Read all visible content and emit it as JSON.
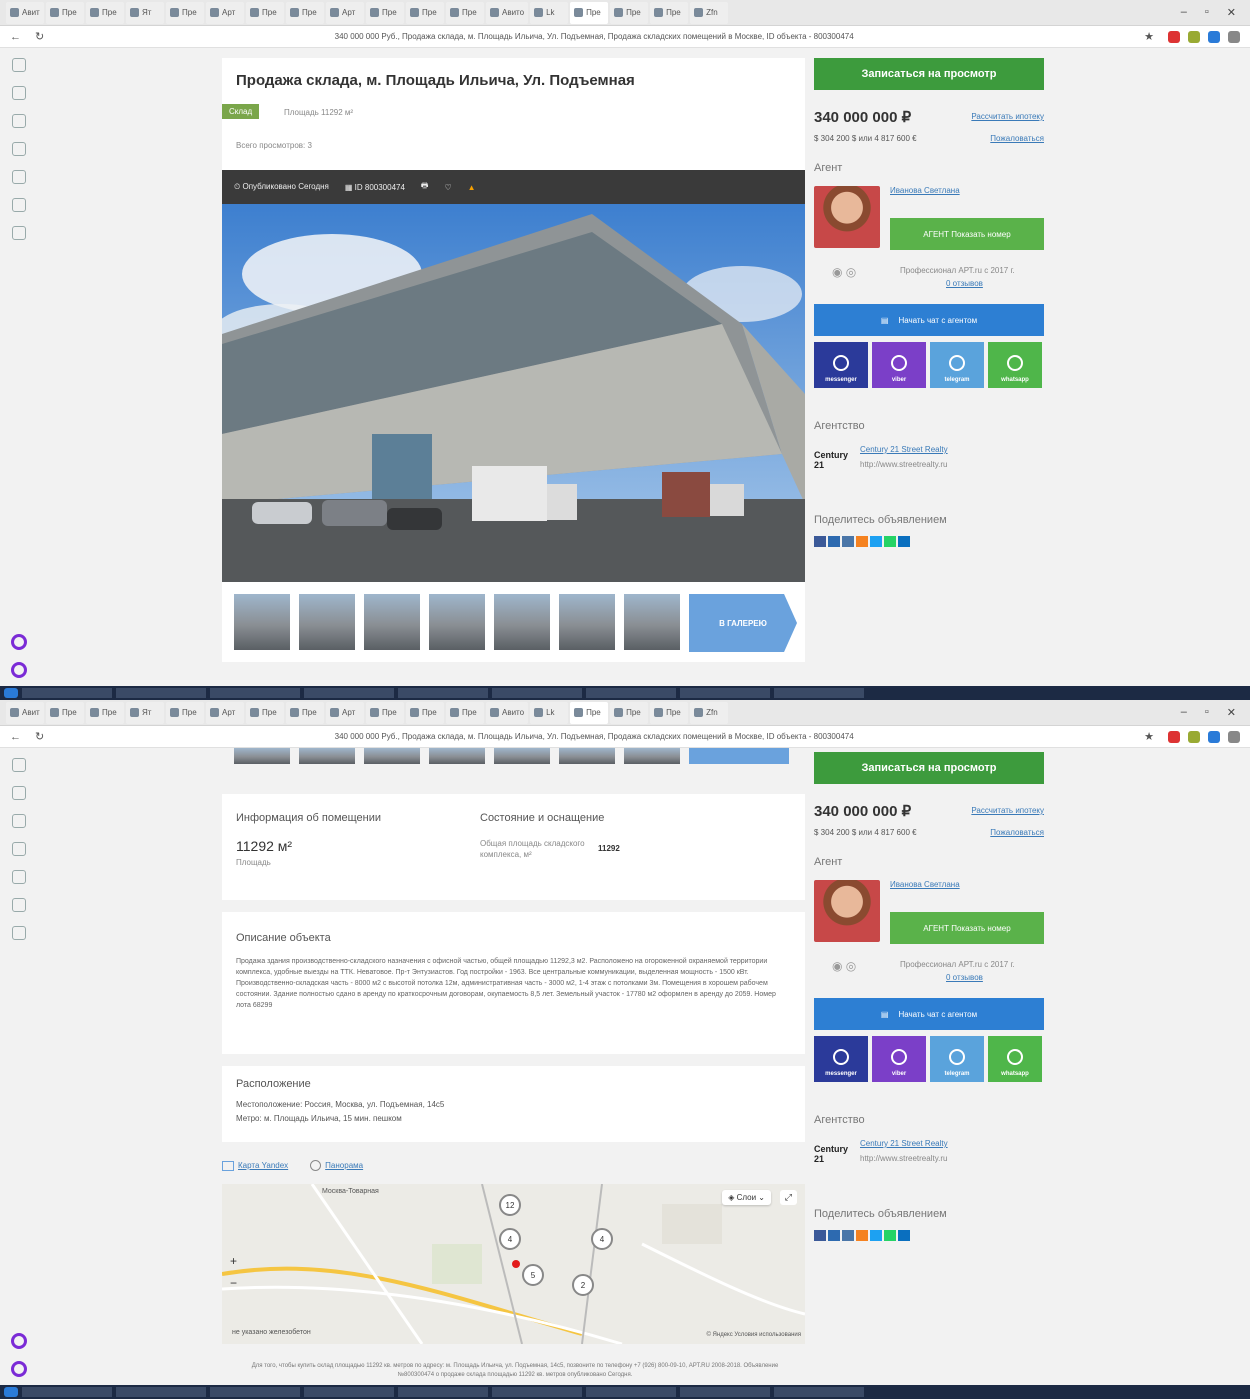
{
  "browser": {
    "tabs": [
      "Авит",
      "Пре",
      "Пре",
      "Ят",
      "Пре",
      "Арт",
      "Пре",
      "Пре",
      "Арт",
      "Пре",
      "Пре",
      "Пре",
      "Авито",
      "Lk",
      "Пре",
      "Пре",
      "Пре",
      "Zfn"
    ],
    "url_text": "340 000 000 Руб., Продажа склада, м. Площадь Ильича, Ул. Подъемная, Продажа складских помещений в Москве, ID объекта - 800300474"
  },
  "listing": {
    "title": "Продажа склада, м. Площадь Ильича, Ул. Подъемная",
    "type_badge": "Склад",
    "area_line": "Площадь 11292 м²",
    "views": "Всего просмотров: 3",
    "toolbar": {
      "published": "Опубликовано Сегодня",
      "object_id": "ID 800300474"
    },
    "gallery_label": "В ГАЛЕРЕЮ"
  },
  "sidebar": {
    "book_button": "Записаться на просмотр",
    "price": "340 000 000 ₽",
    "price_alt": "$ 304 200 $ или 4 817 600 €",
    "calc_link": "Рассчитать ипотеку",
    "complain_link": "Пожаловаться",
    "agent_label": "Агент",
    "agent_name": "Иванова Светлана",
    "phone_button": "АГЕНТ Показать номер",
    "agent_info": "Профессионал АРТ.ru с 2017 г.",
    "agent_reviews": "0 отзывов",
    "chat_button": "Начать чат с агентом",
    "messengers": [
      {
        "name": "messenger",
        "color": "#2b3a9a"
      },
      {
        "name": "viber",
        "color": "#7b3fc8"
      },
      {
        "name": "telegram",
        "color": "#5aa3dc"
      },
      {
        "name": "whatsapp",
        "color": "#4fb64a"
      }
    ],
    "agency_label": "Агентство",
    "agency_name": "Century 21 Street Realty",
    "agency_site": "http://www.streetrealty.ru",
    "agency_logo": "Century 21",
    "share_label": "Поделитесь объявлением",
    "share_colors": [
      "#3b5998",
      "#2d6ab0",
      "#4a76a8",
      "#f58220",
      "#1da1f2",
      "#25d366",
      "#0a6fbf"
    ]
  },
  "info": {
    "premises_title": "Информация об помещении",
    "area_value": "11292 м²",
    "area_caption": "Площадь",
    "state_title": "Состояние и оснащение",
    "state_row_label": "Общая площадь складского комплекса, м²",
    "state_row_value": "11292"
  },
  "description": {
    "title": "Описание объекта",
    "text": "Продажа здания производственно-складского назначения с офисной частью, общей площадью 11292,3 м2. Расположено на огороженной охраняемой территории комплекса, удобные выезды на ТТК. Неватовое. Пр-т Энтузиастов. Год постройки - 1963. Все центральные коммуникации, выделенная мощность - 1500 кВт. Производственно-складская часть - 8000 м2 с высотой потолка 12м, административная часть - 3000 м2, 1-4 этаж с потолками 3м. Помещения в хорошем рабочем состоянии. Здание полностью сдано в аренду по краткосрочным договорам, окупаемость 8,5 лет. Земельный участок - 17780 м2 оформлен в аренду до 2059. Номер лота 68299"
  },
  "location": {
    "title": "Расположение",
    "address_line": "Местоположение: Россия, Москва, ул. Подъемная, 14с5",
    "metro_line": "Метро: м. Площадь Ильича, 15 мин. пешком",
    "map_tab": "Карта Yandex",
    "panorama_tab": "Панорама",
    "map_layer": "Слои",
    "map_place": "Москва-Товарная",
    "map_legend": "не указано  железобетон",
    "map_copyright": "© Яндекс Условия использования",
    "clusters": [
      "12",
      "4",
      "4",
      "5",
      "2"
    ]
  },
  "footer": {
    "note": "Для того, чтобы купить склад площадью 11292 кв. метров по адресу: м. Площадь Ильича, ул. Подъемная, 14с5, позвоните по телефону +7 (926) 800-09-10, АРТ.RU 2008-2018. Объявление №800300474 о продаже склада площадью 11292 кв. метров опубликовано Сегодня."
  }
}
